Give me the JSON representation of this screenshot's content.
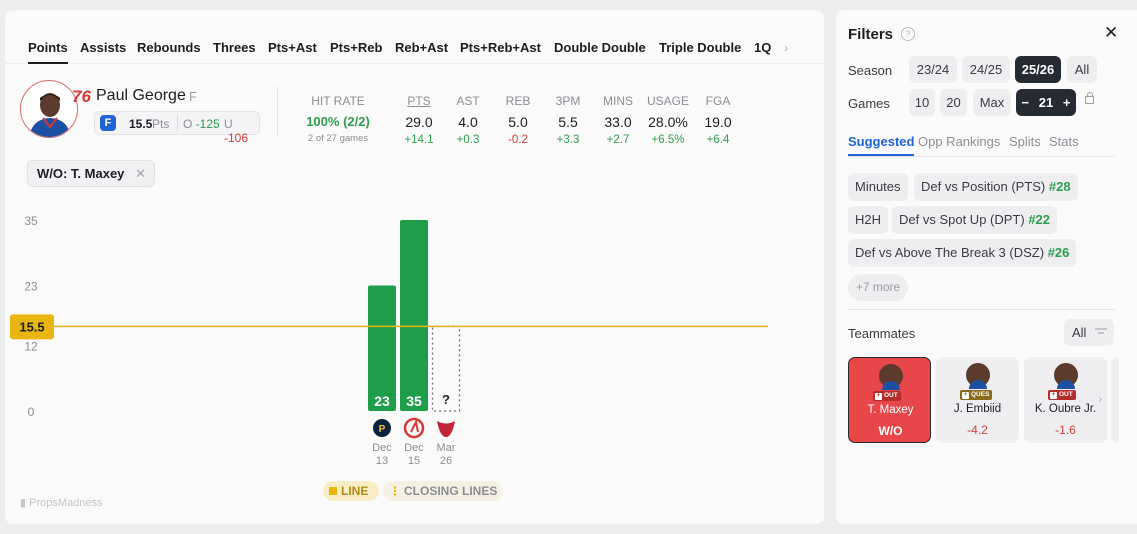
{
  "tabs": [
    "Points",
    "Assists",
    "Rebounds",
    "Threes",
    "Pts+Ast",
    "Pts+Reb",
    "Reb+Ast",
    "Pts+Reb+Ast",
    "Double Double",
    "Triple Double",
    "1Q"
  ],
  "active_tab": "Points",
  "player": {
    "team_logo": "76",
    "name": "Paul George",
    "position": "F",
    "line_value": "15.5",
    "line_unit": "Pts",
    "over_prefix": "O",
    "over_odds": "-125",
    "under_prefix": "U",
    "under_odds": "-106"
  },
  "hit_rate": {
    "label": "HIT RATE",
    "value": "100% (2/2)",
    "sub": "2 of 27 games"
  },
  "stats": [
    {
      "header": "PTS",
      "value": "29.0",
      "delta": "+14.1",
      "dir": "pos"
    },
    {
      "header": "AST",
      "value": "4.0",
      "delta": "+0.3",
      "dir": "pos"
    },
    {
      "header": "REB",
      "value": "5.0",
      "delta": "-0.2",
      "dir": "neg"
    },
    {
      "header": "3PM",
      "value": "5.5",
      "delta": "+3.3",
      "dir": "pos"
    },
    {
      "header": "MINS",
      "value": "33.0",
      "delta": "+2.7",
      "dir": "pos"
    },
    {
      "header": "USAGE",
      "value": "28.0%",
      "delta": "+6.5%",
      "dir": "pos"
    },
    {
      "header": "FGA",
      "value": "19.0",
      "delta": "+6.4",
      "dir": "pos"
    }
  ],
  "filter_chip": {
    "label": "W/O: T. Maxey",
    "remove": "✕"
  },
  "chart_data": {
    "type": "bar",
    "categories": [
      "Dec 13",
      "Dec 15",
      "Mar 26"
    ],
    "opponents": [
      "pacers-logo",
      "hawks-logo",
      "bulls-logo"
    ],
    "values": [
      23,
      35,
      null
    ],
    "pending_label": "?",
    "line": 15.5,
    "line_label": "15.5",
    "yticks": [
      "35",
      "23",
      "12",
      "0"
    ],
    "ylim": [
      0,
      35
    ],
    "bar_color": "#1e9e4a",
    "line_color": "#e9b60f"
  },
  "legend": {
    "line": "LINE",
    "closing": "CLOSING LINES"
  },
  "brand": "PropsMadness",
  "filters": {
    "title": "Filters",
    "help": "?",
    "close": "✕",
    "season_label": "Season",
    "seasons": [
      "23/24",
      "24/25",
      "25/26",
      "All"
    ],
    "selected_season": "25/26",
    "games_label": "Games",
    "games": [
      "10",
      "20",
      "Max"
    ],
    "custom_games": {
      "minus": "−",
      "value": "21",
      "plus": "+"
    }
  },
  "side_tabs": [
    "Suggested",
    "Opp Rankings",
    "Splits",
    "Stats"
  ],
  "suggestions": [
    {
      "label": "Minutes",
      "rank": ""
    },
    {
      "label": "Def vs Position (PTS)",
      "rank": "#28"
    },
    {
      "label": "H2H",
      "rank": ""
    },
    {
      "label": "Def vs Spot Up (DPT)",
      "rank": "#22"
    },
    {
      "label": "Def vs Above The Break 3 (DSZ)",
      "rank": "#26"
    }
  ],
  "more": "+7 more",
  "teammates": {
    "label": "Teammates",
    "filter": "All",
    "cards": [
      {
        "name": "T. Maxey",
        "status": "OUT",
        "value": "W/O"
      },
      {
        "name": "J. Embiid",
        "status": "QUES",
        "value": "-4.2"
      },
      {
        "name": "K. Oubre Jr.",
        "status": "OUT",
        "value": "-1.6"
      }
    ],
    "next": "›"
  }
}
